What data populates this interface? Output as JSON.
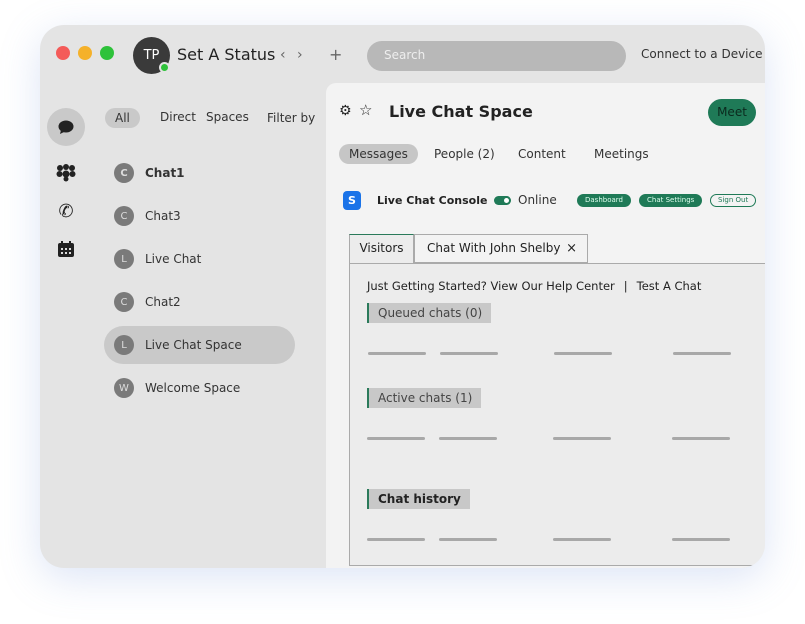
{
  "titlebar": {
    "avatar_initials": "TP",
    "status": "Set A Status",
    "back": "‹",
    "forward": "›",
    "add": "+",
    "search_placeholder": "Search",
    "connect": "Connect to a Device"
  },
  "colors": {
    "accent": "#1f7a57",
    "online": "#2ec23a",
    "close": "#f45b59",
    "minimize": "#f5b12a",
    "maximize": "#2ec23a"
  },
  "nav_icons": [
    "chat-icon",
    "teams-icon",
    "phone-icon",
    "calendar-icon"
  ],
  "filters": {
    "all": "All",
    "direct": "Direct",
    "spaces": "Spaces",
    "filter_by": "Filter by"
  },
  "chats": [
    {
      "initial": "C",
      "name": "Chat1"
    },
    {
      "initial": "C",
      "name": "Chat3"
    },
    {
      "initial": "L",
      "name": "Live Chat"
    },
    {
      "initial": "C",
      "name": "Chat2"
    },
    {
      "initial": "L",
      "name": "Live Chat Space"
    },
    {
      "initial": "W",
      "name": "Welcome Space"
    }
  ],
  "space": {
    "title": "Live Chat Space",
    "meet": "Meet",
    "tabs": [
      "Messages",
      "People (2)",
      "Content",
      "Meetings"
    ],
    "console": {
      "title": "Live Chat Console",
      "online": "Online",
      "dashboard": "Dashboard",
      "chat_settings": "Chat Settings",
      "sign_out": "Sign Out"
    },
    "subtabs": {
      "visitors": "Visitors",
      "chat": "Chat With John Shelby",
      "close": "×"
    },
    "help": "Just Getting Started? View Our Help Center",
    "sep": "|",
    "test": "Test A Chat",
    "sections": {
      "queued": "Queued chats (0)",
      "active": "Active chats (1)",
      "history": "Chat history"
    }
  }
}
